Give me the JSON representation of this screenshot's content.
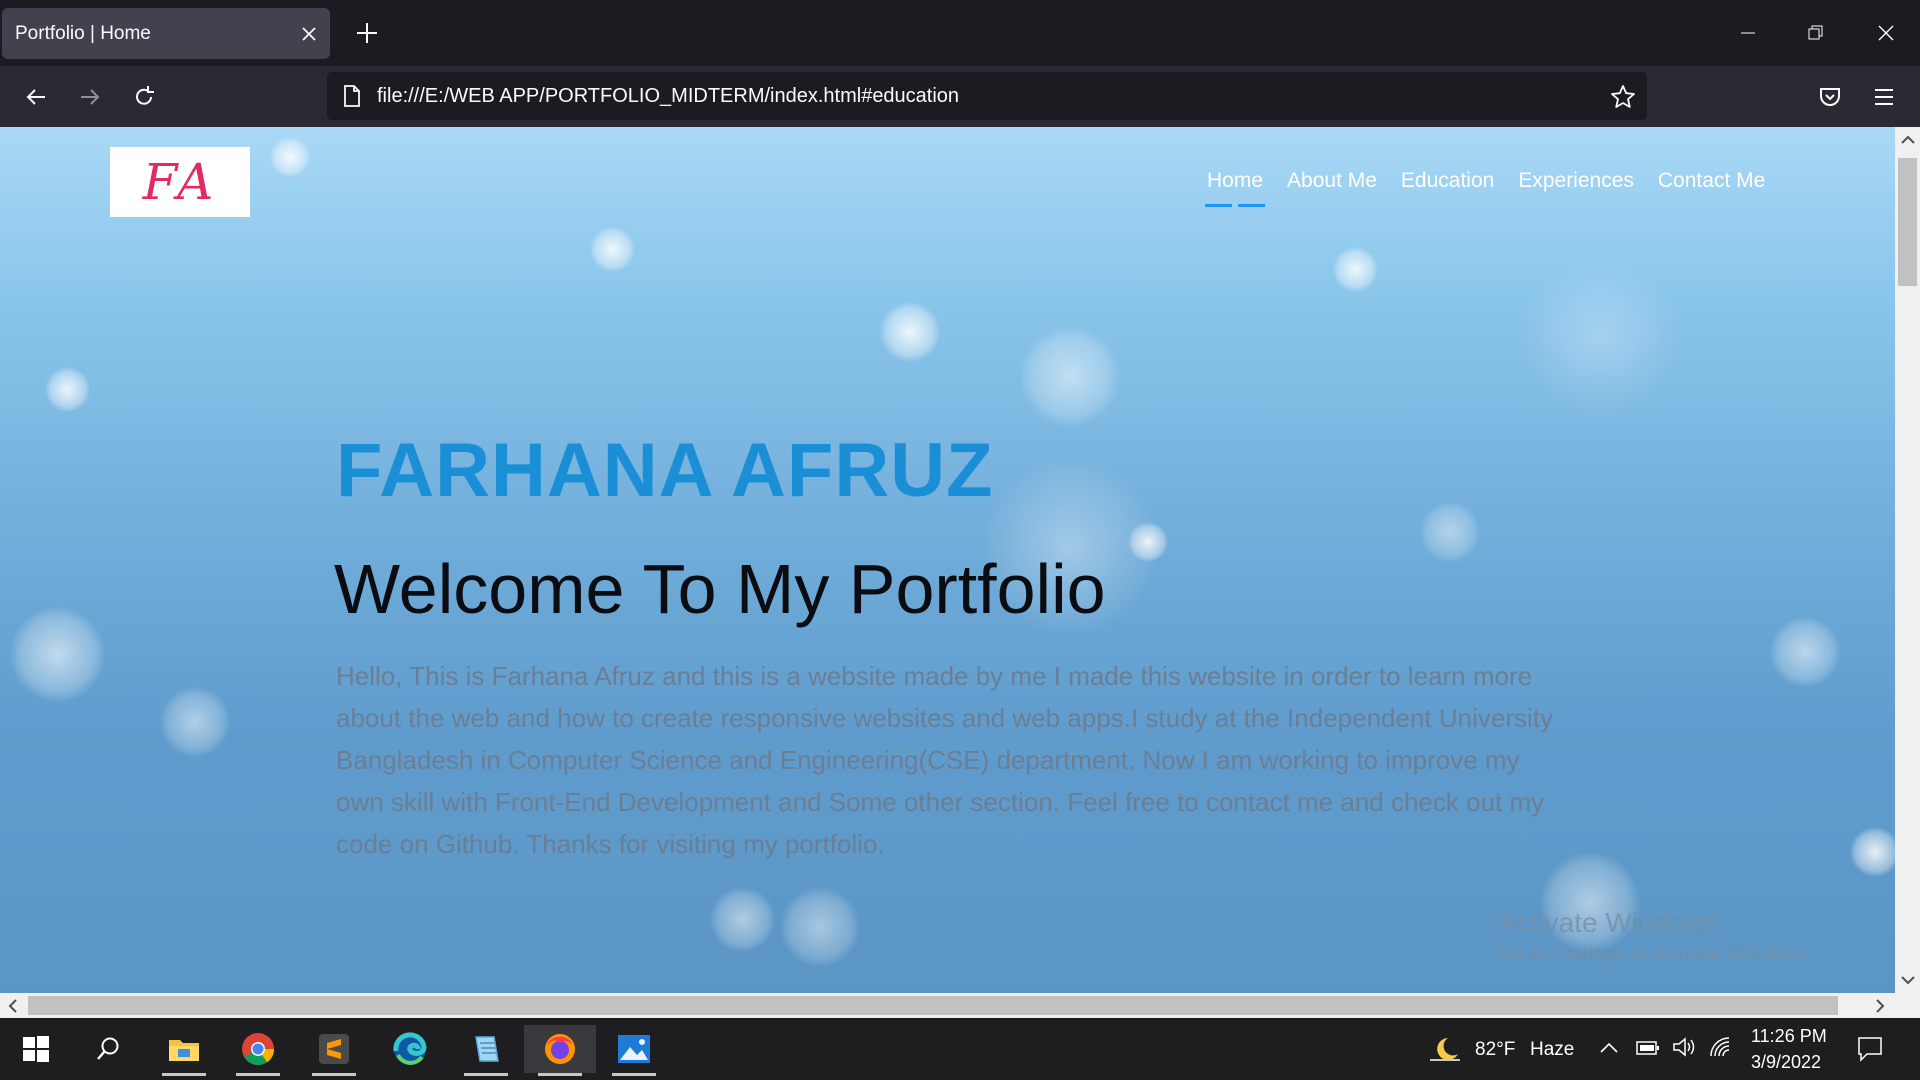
{
  "browser": {
    "tab_title": "Portfolio | Home",
    "url": "file:///E:/WEB APP/PORTFOLIO_MIDTERM/index.html#education"
  },
  "site": {
    "logo_text": "FA",
    "nav": [
      {
        "label": "Home",
        "active": true
      },
      {
        "label": "About Me",
        "active": false
      },
      {
        "label": "Education",
        "active": false
      },
      {
        "label": "Experiences",
        "active": false
      },
      {
        "label": "Contact Me",
        "active": false
      }
    ],
    "hero": {
      "name": "FARHANA AFRUZ",
      "welcome": "Welcome To My Portfolio",
      "intro": "Hello, This is Farhana Afruz and this is a website made by me I made this website in order to learn more about the web and how to create responsive websites and web apps.I study at the Independent University Bangladesh in Computer Science and Engineering(CSE) department. Now I am working to improve my own skill with Front-End Development and Some other section. Feel free to contact me and check out my code on Github. Thanks for visiting my portfolio."
    },
    "colors": {
      "name": "#1b8fd6",
      "nav_active_underline": "#2196f3",
      "logo": "#e02b63"
    }
  },
  "watermark": {
    "line1": "Activate Windows",
    "line2": "Go to Settings to activate Windows."
  },
  "taskbar": {
    "apps": [
      "windows-start",
      "search",
      "file-explorer",
      "chrome",
      "sublime-text",
      "edge",
      "notepad",
      "firefox",
      "photos"
    ],
    "weather": "82°F",
    "weather_desc": "Haze",
    "time": "11:26 PM",
    "date": "3/9/2022"
  }
}
